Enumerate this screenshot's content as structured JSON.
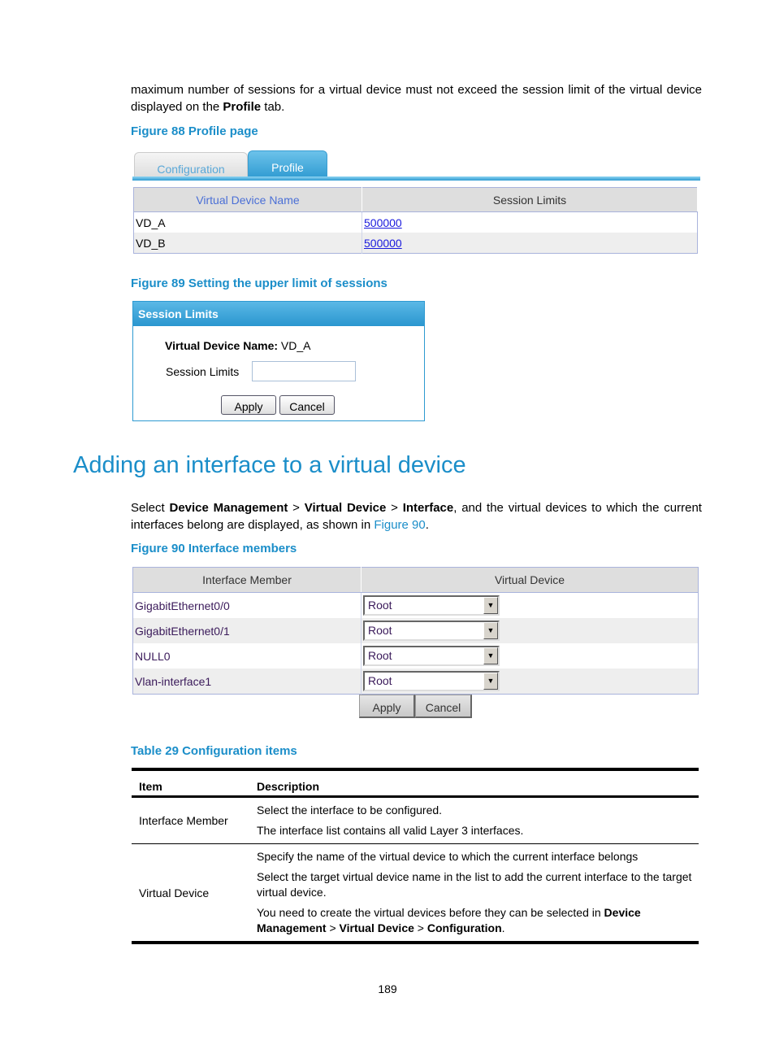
{
  "intro": {
    "text_a": "maximum number of sessions for a virtual device must not exceed the session limit of the virtual device displayed on the ",
    "text_bold": "Profile",
    "text_b": " tab."
  },
  "figure88": {
    "caption": "Figure 88 Profile page",
    "tabs": [
      {
        "label": "Configuration",
        "active": false
      },
      {
        "label": "Profile",
        "active": true
      }
    ],
    "columns": [
      "Virtual Device Name",
      "Session Limits"
    ],
    "rows": [
      {
        "name": "VD_A",
        "limit": "500000"
      },
      {
        "name": "VD_B",
        "limit": "500000"
      }
    ]
  },
  "figure89": {
    "caption": "Figure 89 Setting the upper limit of sessions",
    "panel_title": "Session Limits",
    "name_label": "Virtual Device Name:",
    "name_value": "VD_A",
    "limit_label": "Session Limits",
    "limit_value": "",
    "apply_label": "Apply",
    "cancel_label": "Cancel"
  },
  "section": {
    "heading": "Adding an interface to a virtual device",
    "para": {
      "t1": "Select ",
      "b1": "Device Management",
      "t2": " > ",
      "b2": "Virtual Device",
      "t3": " > ",
      "b3": "Interface",
      "t4": ", and the virtual devices to which the current interfaces belong are displayed, as shown in ",
      "link": "Figure 90",
      "t5": "."
    }
  },
  "figure90": {
    "caption": "Figure 90 Interface members",
    "columns": [
      "Interface Member",
      "Virtual Device"
    ],
    "rows": [
      {
        "interface": "GigabitEthernet0/0",
        "device": "Root"
      },
      {
        "interface": "GigabitEthernet0/1",
        "device": "Root"
      },
      {
        "interface": "NULL0",
        "device": "Root"
      },
      {
        "interface": "Vlan-interface1",
        "device": "Root"
      }
    ],
    "apply_label": "Apply",
    "cancel_label": "Cancel"
  },
  "table29": {
    "caption": "Table 29 Configuration items",
    "headers": [
      "Item",
      "Description"
    ],
    "rows": [
      {
        "item": "Interface Member",
        "desc": [
          "Select the interface to be configured.",
          "The interface list contains all valid Layer 3 interfaces."
        ]
      },
      {
        "item": "Virtual Device",
        "desc": [
          "Specify the name of the virtual device to which the current interface belongs",
          "Select the target virtual device name in the list to add the current interface to the target virtual device."
        ],
        "note": {
          "t1": "You need to create the virtual devices before they can be selected in ",
          "b1": "Device Management",
          "t2": " > ",
          "b2": "Virtual Device",
          "t3": " > ",
          "b3": "Configuration",
          "t4": "."
        }
      }
    ]
  },
  "page_number": "189"
}
